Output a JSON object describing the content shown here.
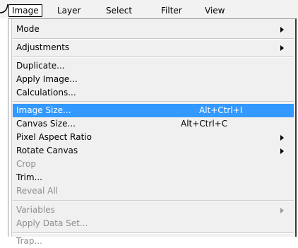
{
  "menubar": {
    "items": [
      "Image",
      "Layer",
      "Select",
      "Filter",
      "View"
    ],
    "active_index": 0
  },
  "menu": {
    "items": [
      {
        "label": "Mode",
        "shortcut": "",
        "submenu": true,
        "enabled": true
      },
      {
        "label": "Adjustments",
        "shortcut": "",
        "submenu": true,
        "enabled": true
      },
      {
        "label": "Duplicate...",
        "shortcut": "",
        "submenu": false,
        "enabled": true
      },
      {
        "label": "Apply Image...",
        "shortcut": "",
        "submenu": false,
        "enabled": true
      },
      {
        "label": "Calculations...",
        "shortcut": "",
        "submenu": false,
        "enabled": true
      },
      {
        "label": "Image Size...",
        "shortcut": "Alt+Ctrl+I",
        "submenu": false,
        "enabled": true,
        "highlighted": true
      },
      {
        "label": "Canvas Size...",
        "shortcut": "Alt+Ctrl+C",
        "submenu": false,
        "enabled": true
      },
      {
        "label": "Pixel Aspect Ratio",
        "shortcut": "",
        "submenu": true,
        "enabled": true
      },
      {
        "label": "Rotate Canvas",
        "shortcut": "",
        "submenu": true,
        "enabled": true
      },
      {
        "label": "Crop",
        "shortcut": "",
        "submenu": false,
        "enabled": false
      },
      {
        "label": "Trim...",
        "shortcut": "",
        "submenu": false,
        "enabled": true
      },
      {
        "label": "Reveal All",
        "shortcut": "",
        "submenu": false,
        "enabled": false
      },
      {
        "label": "Variables",
        "shortcut": "",
        "submenu": true,
        "enabled": false
      },
      {
        "label": "Apply Data Set...",
        "shortcut": "",
        "submenu": false,
        "enabled": false
      },
      {
        "label": "Trap...",
        "shortcut": "",
        "submenu": false,
        "enabled": false
      }
    ]
  },
  "colors": {
    "highlight": "#3399ff",
    "menu_bg": "#f0f0f0",
    "disabled_text": "#8d8d8d"
  }
}
